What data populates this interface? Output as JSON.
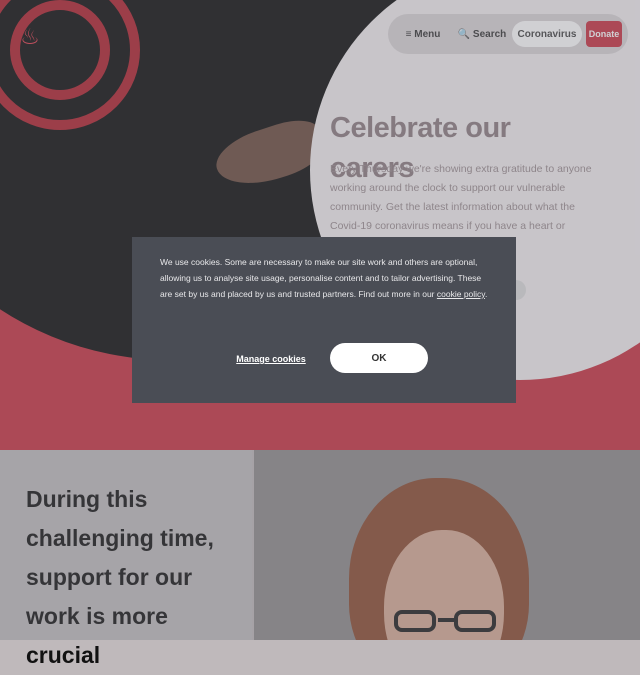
{
  "nav": {
    "menu_label": "≡ Menu",
    "search_label": "🔍 Search",
    "coronavirus_label": "Coronavirus",
    "donate_label": "Donate"
  },
  "hero": {
    "heading": "Celebrate our carers",
    "text": "Every Thursday we're showing extra gratitude to anyone working around the clock to support our vulnerable community. Get the latest information about what the Covid-19 coronavirus means if you have a heart or circulatory"
  },
  "cookie": {
    "text_before": "We use cookies. Some are necessary to make our site work and others are optional, allowing us to analyse site usage, personalise content and to tailor advertising. These are set by us and placed by us and trusted partners. Find out more in our ",
    "link_label": "cookie policy",
    "text_after": ".",
    "manage_label": "Manage cookies",
    "ok_label": "OK"
  },
  "section": {
    "heading": "During this challenging time, support for our work is more crucial"
  },
  "icons": {
    "logo": "flame-logo-icon"
  },
  "colors": {
    "brand_red": "#c8303f",
    "modal_bg": "#4a4d55"
  }
}
